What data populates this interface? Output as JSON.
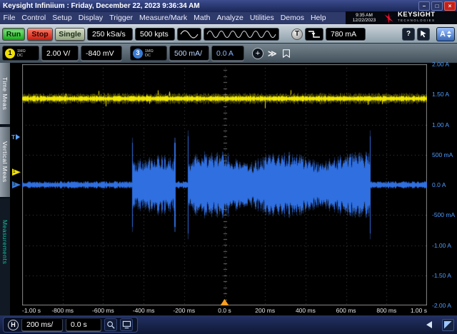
{
  "window": {
    "title": "Keysight Infiniium : Friday, December 22, 2023 9:36:34 AM",
    "minimize_glyph": "–",
    "maximize_glyph": "□",
    "close_glyph": "×"
  },
  "menu": {
    "items": [
      "File",
      "Control",
      "Setup",
      "Display",
      "Trigger",
      "Measure/Mark",
      "Math",
      "Analyze",
      "Utilities",
      "Demos",
      "Help"
    ]
  },
  "clock": {
    "time": "9:35 AM",
    "date": "12/22/2023"
  },
  "brand": {
    "name": "KEYSIGHT",
    "subtitle": "TECHNOLOGIES"
  },
  "toolbar": {
    "run": "Run",
    "stop": "Stop",
    "single": "Single",
    "sample_rate": "250 kSa/s",
    "memory_depth": "500 kpts",
    "trigger_label": "T",
    "trigger_level": "780 mA",
    "help_glyph": "?",
    "autoscale_glyph": "A"
  },
  "channels": {
    "ch1": {
      "number": "1",
      "impedance": "1MΩ",
      "coupling": "DC",
      "scale": "2.00 V/",
      "offset": "-840 mV"
    },
    "ch3": {
      "number": "3",
      "impedance": "1MΩ",
      "coupling": "DC",
      "scale": "500 mA/",
      "offset": "0.0 A"
    },
    "add_glyph": "+",
    "more_glyph": "≫"
  },
  "sidebar": {
    "tab_time": "Time Meas",
    "tab_vertical": "Vertical Meas",
    "measurements": "Measurements"
  },
  "horizontal": {
    "h_glyph": "H",
    "timebase": "200 ms/",
    "position": "0.0 s"
  },
  "axes": {
    "right": [
      "2.00 A",
      "1.50 A",
      "1.00 A",
      "500 mA",
      "0.0 A",
      "-500 mA",
      "-1.00 A",
      "-1.50 A",
      "-2.00 A"
    ],
    "bottom": [
      "-1.00 s",
      "-800 ms",
      "-600 ms",
      "-400 ms",
      "-200 ms",
      "0.0 s",
      "200 ms",
      "400 ms",
      "600 ms",
      "800 ms",
      "1.00 s"
    ]
  },
  "markers": {
    "trigger_glyph": "T",
    "ch1_number": "1",
    "ch3_number": "3",
    "trigger_level_a": 0.78,
    "ch1_ground_a": 0.21,
    "ch3_ground_a": 0.0,
    "trigger_time_s": 0.0
  },
  "waveforms": {
    "time_range": [
      -1.0,
      1.0
    ],
    "amp_range": [
      -2.0,
      2.0
    ],
    "yellow": {
      "center_a": 1.43,
      "noise_a": 0.05,
      "color": "#f0e800"
    },
    "blue": {
      "baseline_a": 0.04,
      "color": "#2f6fe0",
      "bursts": [
        {
          "t0": -0.46,
          "t1": -0.245,
          "amp": 0.45
        },
        {
          "t0": -0.185,
          "t1": 0.72,
          "amp": 0.52
        }
      ]
    },
    "grid_color": "#454545",
    "accent_blue": "#4f9dff",
    "trigger_orange": "#ff9e1e"
  }
}
